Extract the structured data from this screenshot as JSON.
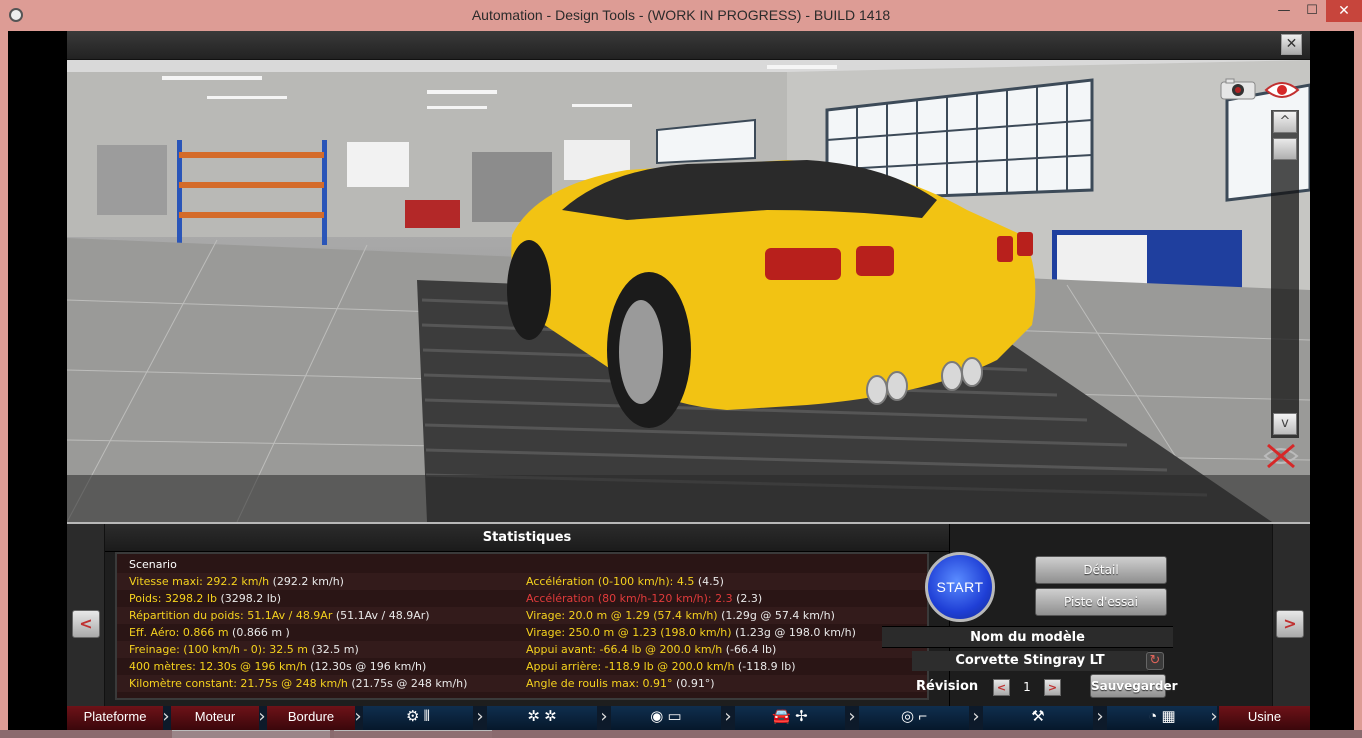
{
  "window": {
    "title": "Automation - Design Tools - (WORK IN PROGRESS) - BUILD 1418",
    "minimize": "—",
    "maximize": "☐",
    "close": "✕"
  },
  "viewport": {
    "close_label": "✕",
    "scroll_up": "^",
    "scroll_down": "v"
  },
  "stats": {
    "header": "Statistiques",
    "scenario": "Scenario",
    "rows": [
      {
        "left": {
          "label": "Vitesse maxi: 292.2 km/h",
          "value": " (292.2 km/h)"
        },
        "right": {
          "label": "Accélération (0-100 km/h): 4.5",
          "value": " (4.5)",
          "red": false
        }
      },
      {
        "left": {
          "label": "Poids: 3298.2 lb",
          "value": " (3298.2 lb)"
        },
        "right": {
          "label": "Accélération (80 km/h-120 km/h): 2.3",
          "value": " (2.3)",
          "red": true
        }
      },
      {
        "left": {
          "label": "Répartition du poids: 51.1Av / 48.9Ar",
          "value": " (51.1Av / 48.9Ar)"
        },
        "right": {
          "label": "Virage: 20.0 m @ 1.29 (57.4 km/h)",
          "value": " (1.29g @ 57.4 km/h)",
          "red": false
        }
      },
      {
        "left": {
          "label": "Eff. Aéro: 0.866 m",
          "value": "  (0.866 m )"
        },
        "right": {
          "label": "Virage: 250.0 m @ 1.23 (198.0 km/h)",
          "value": " (1.23g @ 198.0 km/h)",
          "red": false
        }
      },
      {
        "left": {
          "label": "Freinage: (100 km/h - 0): 32.5 m",
          "value": "  (32.5 m)"
        },
        "right": {
          "label": "Appui avant: -66.4 lb @ 200.0 km/h",
          "value": " (-66.4 lb)",
          "red": false
        }
      },
      {
        "left": {
          "label": "400 mètres: 12.30s @ 196 km/h",
          "value": " (12.30s @ 196 km/h)"
        },
        "right": {
          "label": "Appui arrière: -118.9 lb @ 200.0 km/h",
          "value": " (-118.9 lb)",
          "red": false
        }
      },
      {
        "left": {
          "label": "Kilomètre constant: 21.75s @ 248 km/h",
          "value": " (21.75s @ 248 km/h)"
        },
        "right": {
          "label": "Angle de roulis max: 0.91°",
          "value": " (0.91°)",
          "red": false
        }
      }
    ]
  },
  "controls": {
    "prev": "<",
    "next": ">",
    "start": "START",
    "detail": "Détail",
    "test_track": "Piste d'essai",
    "model_header": "Nom du modèle",
    "model_name": "Corvette  Stingray LT",
    "revision_label": "Révision",
    "revision_value": "1",
    "rev_dec": "<",
    "rev_inc": ">",
    "save": "Sauvegarder"
  },
  "navbar": {
    "tabs": [
      "Plateforme",
      "Moteur",
      "Bordure",
      "Usine"
    ],
    "icons": [
      "engine-gearbox-icon",
      "wheels-icon",
      "body-fixtures-icon",
      "car-aero-icon",
      "interior-icon",
      "safety-icon",
      "testing-icon"
    ],
    "colors": {
      "red_tab": "#6e1218",
      "blue_tab": "#0f2e4e"
    }
  }
}
